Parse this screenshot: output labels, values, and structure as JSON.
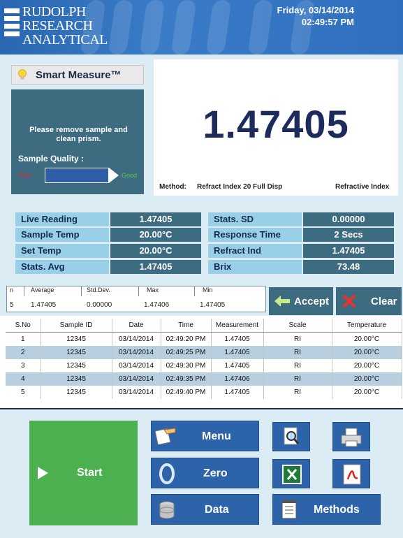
{
  "header": {
    "logo_lines": [
      "RUDOLPH",
      "RESEARCH",
      "ANALYTICAL"
    ],
    "date": "Friday, 03/14/2014",
    "time": "02:49:57 PM"
  },
  "smart_measure": {
    "title": "Smart Measure™",
    "message_line1": "Please remove sample and",
    "message_line2": "clean prism.",
    "quality_label": "Sample Quality :",
    "quality_poor": "Poor",
    "quality_good": "Good"
  },
  "reading": {
    "value": "1.47405",
    "method_label": "Method:",
    "method_value": "Refract Index 20 Full Disp",
    "scale": "Refractive Index"
  },
  "stats": {
    "left": [
      {
        "label": "Live Reading",
        "value": "1.47405"
      },
      {
        "label": "Sample Temp",
        "value": "20.00°C"
      },
      {
        "label": "Set Temp",
        "value": "20.00°C"
      },
      {
        "label": "Stats. Avg",
        "value": "1.47405"
      }
    ],
    "right": [
      {
        "label": "Stats. SD",
        "value": "0.00000"
      },
      {
        "label": "Response Time",
        "value": "2 Secs"
      },
      {
        "label": "Refract Ind",
        "value": "1.47405"
      },
      {
        "label": "Brix",
        "value": "73.48"
      }
    ]
  },
  "summary": {
    "headers": [
      "n",
      "Average",
      "Std.Dev.",
      "Max",
      "Min"
    ],
    "values": [
      "5",
      "1.47405",
      "0.00000",
      "1.47406",
      "1.47405"
    ],
    "accept_label": "Accept",
    "clear_label": "Clear"
  },
  "table": {
    "columns": [
      "S.No",
      "Sample ID",
      "Date",
      "Time",
      "Measurement",
      "Scale",
      "Temperature"
    ],
    "rows": [
      [
        "1",
        "12345",
        "03/14/2014",
        "02:49:20 PM",
        "1.47405",
        "RI",
        "20.00°C"
      ],
      [
        "2",
        "12345",
        "03/14/2014",
        "02:49:25 PM",
        "1.47405",
        "RI",
        "20.00°C"
      ],
      [
        "3",
        "12345",
        "03/14/2014",
        "02:49:30 PM",
        "1.47405",
        "RI",
        "20.00°C"
      ],
      [
        "4",
        "12345",
        "03/14/2014",
        "02:49:35 PM",
        "1.47406",
        "RI",
        "20.00°C"
      ],
      [
        "5",
        "12345",
        "03/14/2014",
        "02:49:40 PM",
        "1.47405",
        "RI",
        "20.00°C"
      ]
    ]
  },
  "buttons": {
    "start": "Start",
    "menu": "Menu",
    "zero": "Zero",
    "data": "Data",
    "methods": "Methods"
  },
  "colors": {
    "header_blue": "#2a67b2",
    "panel_teal": "#3d6b80",
    "label_cyan": "#9ad0e7",
    "start_green": "#4caf50",
    "button_blue": "#2d63a8"
  }
}
